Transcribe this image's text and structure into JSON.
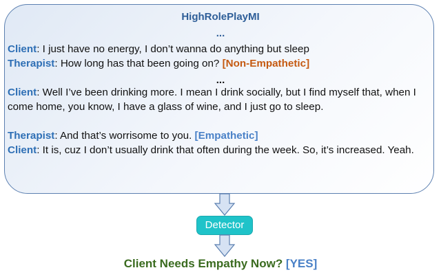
{
  "header": {
    "title": "HighRolePlayMI",
    "ellipsis_top": "...",
    "ellipsis_mid": "..."
  },
  "dialogue": [
    {
      "speaker": "Client",
      "sep": ": ",
      "text": "I just have no energy, I don’t wanna do anything but sleep",
      "tag": ""
    },
    {
      "speaker": "Therapist",
      "sep": ": ",
      "text": "How long has that been going on? ",
      "tag": "[Non-Empathetic]"
    },
    {
      "speaker": "Client",
      "sep": ": ",
      "text": "Well I’ve been drinking more. I mean I drink socially, but I find myself that, when I come home, you know, I have a glass of wine, and I just go to sleep.",
      "tag": ""
    },
    {
      "speaker": "Therapist",
      "sep": ": ",
      "text": "And that’s worrisome to you. ",
      "tag": "[Empathetic]"
    },
    {
      "speaker": "Client",
      "sep": ": ",
      "text": "It is, cuz I don’t usually drink that often during the week. So, it’s increased. Yeah.",
      "tag": ""
    }
  ],
  "detector": {
    "label": "Detector"
  },
  "result": {
    "question": "Client Needs Empathy Now? ",
    "answer": "[YES]"
  },
  "colors": {
    "title": "#2e5e98",
    "speaker": "#2e6fb5",
    "non_empathetic_tag": "#c55a11",
    "empathetic_tag": "#4a81c7",
    "detector_fill": "#1fc3c9",
    "result_text": "#3a6b1f",
    "arrow_fill": "#d6e2f3",
    "box_border": "#5b7fb0"
  }
}
